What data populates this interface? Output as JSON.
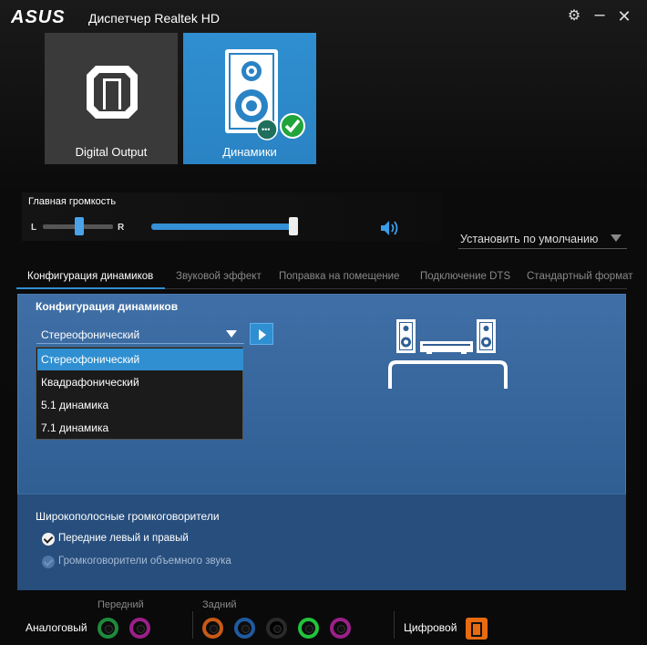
{
  "window": {
    "brand": "ASUS",
    "title": "Диспетчер Realtek HD"
  },
  "devices": [
    {
      "label": "Digital Output",
      "icon": "digital-output-icon",
      "selected": false
    },
    {
      "label": "Динамики",
      "icon": "speakers-icon",
      "selected": true
    }
  ],
  "volume": {
    "title": "Главная громкость",
    "left_label": "L",
    "right_label": "R",
    "balance_fraction": 0.5,
    "level_fraction": 0.97
  },
  "set_default": {
    "label": "Установить по умолчанию"
  },
  "tabs": [
    {
      "label": "Конфигурация динамиков",
      "active": true
    },
    {
      "label": "Звуковой эффект",
      "active": false
    },
    {
      "label": "Поправка на помещение",
      "active": false
    },
    {
      "label": "Подключение DTS",
      "active": false
    },
    {
      "label": "Стандартный формат",
      "active": false
    }
  ],
  "config": {
    "section_title": "Конфигурация динамиков",
    "selected_value": "Стереофонический",
    "options": [
      "Стереофонический",
      "Квадрафонический",
      "5.1 динамика",
      "7.1 динамика"
    ]
  },
  "wideband": {
    "title": "Широкополосные громкоговорители",
    "front_label": "Передние левый и правый",
    "front_checked": true,
    "surround_label": "Громкоговорители объемного звука",
    "surround_checked": true,
    "surround_enabled": false
  },
  "jacks": {
    "analog_label": "Аналоговый",
    "front_label": "Передний",
    "rear_label": "Задний",
    "digital_label": "Цифровой",
    "front_colors": [
      "#1e8a3c",
      "#9c1f8a"
    ],
    "rear_colors": [
      "#c65a17",
      "#1f5aa0",
      "#2a2a2a",
      "#22c23c",
      "#9c1f8a"
    ],
    "digital_color": "#e86b10"
  },
  "colors": {
    "accent": "#2f8fd0",
    "panel": "#3f6fa6"
  }
}
